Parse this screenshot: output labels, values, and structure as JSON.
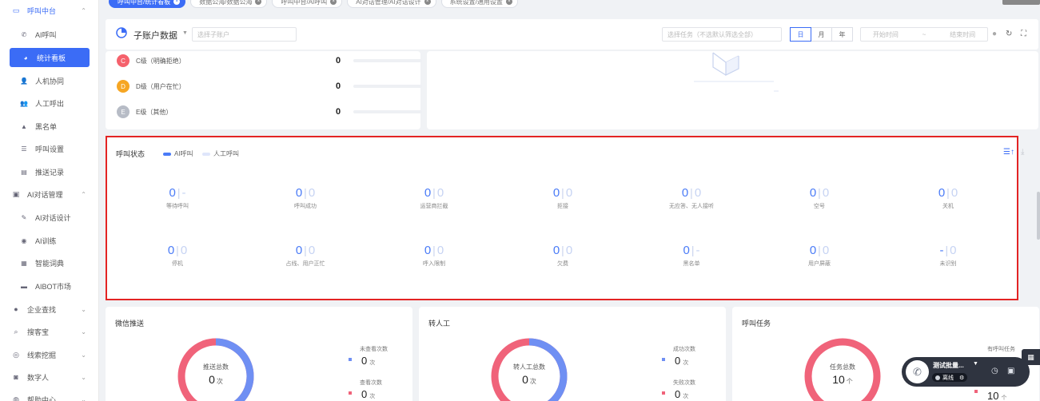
{
  "sidebar": {
    "items": [
      {
        "label": "呼叫中台",
        "icon": "monitor-icon",
        "level": "top",
        "state": "group-active",
        "chev": "^"
      },
      {
        "label": "AI呼叫",
        "icon": "phone-icon",
        "level": "sub"
      },
      {
        "label": "统计看板",
        "icon": "pie-chart-icon",
        "level": "sub",
        "state": "active"
      },
      {
        "label": "人机协同",
        "icon": "user-icon",
        "level": "sub"
      },
      {
        "label": "人工呼出",
        "icon": "users-icon",
        "level": "sub"
      },
      {
        "label": "黑名单",
        "icon": "warning-icon",
        "level": "sub"
      },
      {
        "label": "呼叫设置",
        "icon": "sliders-icon",
        "level": "sub"
      },
      {
        "label": "推送记录",
        "icon": "record-icon",
        "level": "sub"
      },
      {
        "label": "AI对话管理",
        "icon": "dialog-icon",
        "level": "top",
        "chev": "^"
      },
      {
        "label": "AI对话设计",
        "icon": "pen-icon",
        "level": "sub"
      },
      {
        "label": "AI训练",
        "icon": "train-icon",
        "level": "sub"
      },
      {
        "label": "智能词典",
        "icon": "book-icon",
        "level": "sub"
      },
      {
        "label": "AIBOT市场",
        "icon": "market-icon",
        "level": "sub"
      },
      {
        "label": "企业查找",
        "icon": "bulb-icon",
        "level": "top",
        "chev": "v"
      },
      {
        "label": "搜客宝",
        "icon": "search-icon",
        "level": "top",
        "chev": "v"
      },
      {
        "label": "线索挖掘",
        "icon": "target-icon",
        "level": "top",
        "chev": "v"
      },
      {
        "label": "数字人",
        "icon": "digital-human-icon",
        "level": "top",
        "chev": "v"
      },
      {
        "label": "帮助中心",
        "icon": "help-icon",
        "level": "top",
        "chev": "v"
      }
    ]
  },
  "tabs": [
    {
      "label": "呼叫中台/统计看板",
      "active": true
    },
    {
      "label": "数据公海/数据公海"
    },
    {
      "label": "呼叫中台/AI呼叫"
    },
    {
      "label": "AI对话管理/AI对话设计"
    },
    {
      "label": "系统设置/通用设置"
    }
  ],
  "filter": {
    "title": "子账户数据",
    "subaccount_placeholder": "选择子账户",
    "task_placeholder": "选择任务（不选默认筛选全部）",
    "periods": [
      "日",
      "月",
      "年"
    ],
    "active_period": "日",
    "start_placeholder": "开始时间",
    "range_sep": "~",
    "end_placeholder": "结束时间"
  },
  "grades": [
    {
      "label": "C级（明确拒绝）",
      "value": "0",
      "color": "#f5616c",
      "letter": "C"
    },
    {
      "label": "D级（用户在忙）",
      "value": "0",
      "color": "#f6a623",
      "letter": "D"
    },
    {
      "label": "E级（其他）",
      "value": "0",
      "color": "#b7bcc6",
      "letter": "E"
    }
  ],
  "call_status": {
    "title": "呼叫状态",
    "legend": [
      {
        "label": "AI呼叫",
        "color": "#4a7bf7"
      },
      {
        "label": "人工呼叫",
        "color": "#dfe6fb"
      }
    ],
    "row1": [
      {
        "ai": "0",
        "manual": "-",
        "label": "等待呼叫"
      },
      {
        "ai": "0",
        "manual": "0",
        "label": "呼叫成功"
      },
      {
        "ai": "0",
        "manual": "0",
        "label": "运营商拦截"
      },
      {
        "ai": "0",
        "manual": "0",
        "label": "拒接"
      },
      {
        "ai": "0",
        "manual": "0",
        "label": "无应答、无人接听"
      },
      {
        "ai": "0",
        "manual": "0",
        "label": "空号"
      },
      {
        "ai": "0",
        "manual": "0",
        "label": "关机"
      }
    ],
    "row2": [
      {
        "ai": "0",
        "manual": "0",
        "label": "停机"
      },
      {
        "ai": "0",
        "manual": "0",
        "label": "占线、用户正忙"
      },
      {
        "ai": "0",
        "manual": "0",
        "label": "呼入限制"
      },
      {
        "ai": "0",
        "manual": "0",
        "label": "欠费"
      },
      {
        "ai": "0",
        "manual": "-",
        "label": "黑名单"
      },
      {
        "ai": "0",
        "manual": "0",
        "label": "用户屏蔽"
      },
      {
        "ai": "-",
        "manual": "0",
        "label": "未识别"
      }
    ]
  },
  "wechat": {
    "title": "微信推送",
    "center_label": "推送总数",
    "center_value": "0",
    "center_unit": "次",
    "legend": [
      {
        "label": "未查看次数",
        "value": "0",
        "unit": "次",
        "color": "#6f8ff3"
      },
      {
        "label": "查看次数",
        "value": "0",
        "unit": "次",
        "color": "#f0637a"
      }
    ]
  },
  "transfer": {
    "title": "转人工",
    "center_label": "转人工总数",
    "center_value": "0",
    "center_unit": "次",
    "legend": [
      {
        "label": "成功次数",
        "value": "0",
        "unit": "次",
        "color": "#6f8ff3"
      },
      {
        "label": "失败次数",
        "value": "0",
        "unit": "次",
        "color": "#f0637a"
      }
    ]
  },
  "tasks": {
    "title": "呼叫任务",
    "center_label": "任务总数",
    "center_value": "10",
    "center_unit": "个",
    "legend": [
      {
        "label": "有呼叫任务",
        "value": "10",
        "unit": "个",
        "color": "#f0637a"
      }
    ]
  },
  "float_widget": {
    "name": "测试批量...",
    "status": "离线"
  },
  "colors": {
    "primary": "#3b6cf6",
    "highlight_border": "#e32424",
    "donut_red": "#f0637a",
    "donut_blue": "#6f8ff3"
  }
}
